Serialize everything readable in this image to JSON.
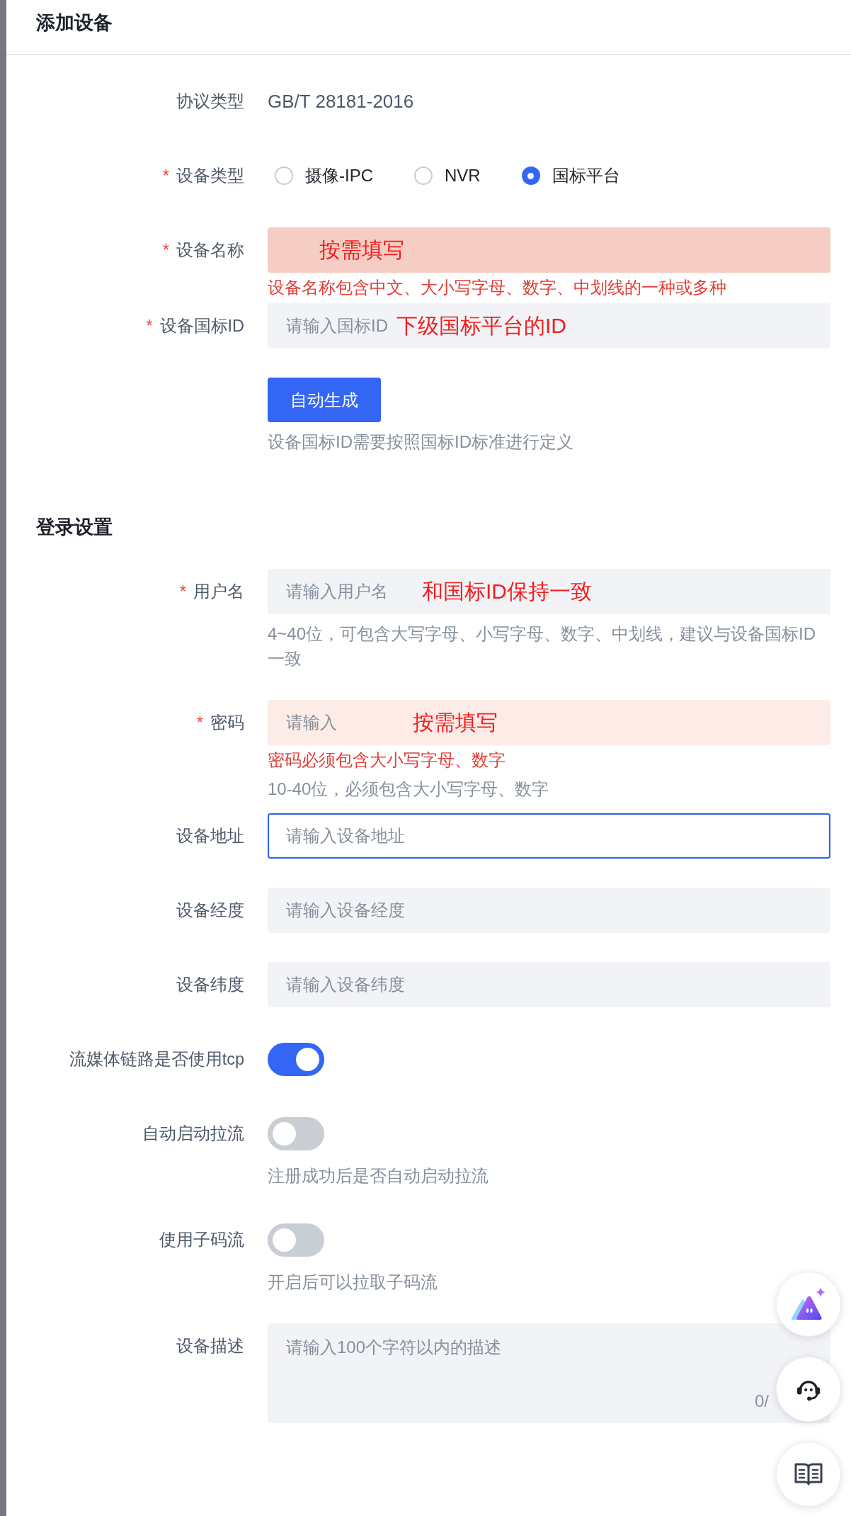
{
  "drawer": {
    "title": "添加设备"
  },
  "form_items": [
    {
      "kind": "static",
      "label": "协议类型",
      "value": "GB/T 28181-2016"
    },
    {
      "kind": "radio",
      "label": "设备类型",
      "required_mark": "*",
      "options": [
        {
          "label": "摄像-IPC",
          "selected": false
        },
        {
          "label": "NVR",
          "selected": false
        },
        {
          "label": "国标平台",
          "selected": true
        }
      ]
    },
    {
      "kind": "input",
      "label": "设备名称",
      "required_mark": "*",
      "invalid": true,
      "hovered": true,
      "focused": false,
      "annotation": "按需填写",
      "error": "设备名称包含中文、大小写字母、数字、中划线的一种或多种"
    },
    {
      "kind": "input",
      "label": "设备国标ID",
      "required_mark": "*",
      "invalid": false,
      "hovered": false,
      "focused": false,
      "placeholder": "请输入国标ID",
      "annotation": "下级国标平台的ID",
      "button": "自动生成",
      "hint": "设备国标ID需要按照国标ID标准进行定义"
    },
    {
      "kind": "section",
      "title": "登录设置"
    },
    {
      "kind": "input",
      "label": "用户名",
      "required_mark": "*",
      "invalid": false,
      "hovered": false,
      "focused": false,
      "placeholder": "请输入用户名",
      "annotation": "和国标ID保持一致",
      "hint": "4~40位，可包含大写字母、小写字母、数字、中划线，建议与设备国标ID一致"
    },
    {
      "kind": "input",
      "label": "密码",
      "required_mark": "*",
      "invalid": true,
      "hovered": false,
      "focused": false,
      "placeholder": "请输入",
      "annotation": "按需填写",
      "error": "密码必须包含大小写字母、数字",
      "hint": "10-40位，必须包含大小写字母、数字"
    },
    {
      "kind": "input",
      "label": "设备地址",
      "invalid": false,
      "hovered": false,
      "focused": true,
      "placeholder": "请输入设备地址"
    },
    {
      "kind": "input",
      "label": "设备经度",
      "invalid": false,
      "hovered": false,
      "focused": false,
      "placeholder": "请输入设备经度"
    },
    {
      "kind": "input",
      "label": "设备纬度",
      "invalid": false,
      "hovered": false,
      "focused": false,
      "placeholder": "请输入设备纬度"
    },
    {
      "kind": "switch",
      "label": "流媒体链路是否使用tcp",
      "on": true
    },
    {
      "kind": "switch",
      "label": "自动启动拉流",
      "on": false,
      "hint": "注册成功后是否自动启动拉流"
    },
    {
      "kind": "switch",
      "label": "使用子码流",
      "on": false,
      "hint": "开启后可以拉取子码流"
    },
    {
      "kind": "textarea",
      "label": "设备描述",
      "placeholder": "请输入100个字符以内的描述",
      "counter": "0/"
    }
  ],
  "floating_buttons": [
    {
      "kind": "ai"
    },
    {
      "kind": "support"
    },
    {
      "kind": "docs"
    }
  ]
}
